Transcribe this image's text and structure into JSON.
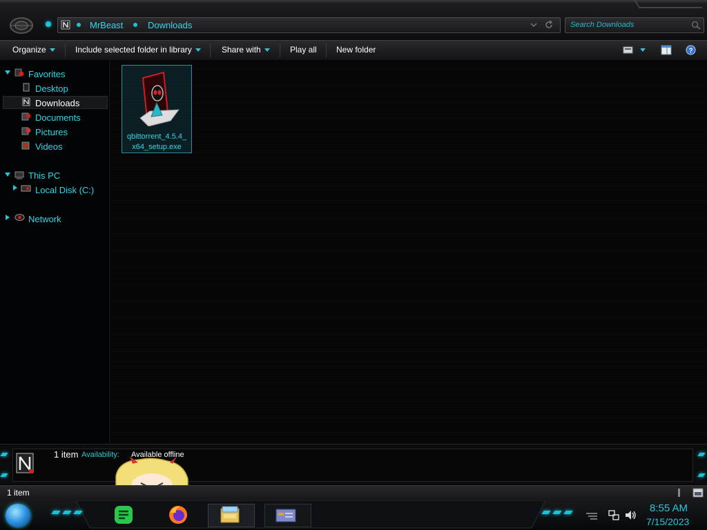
{
  "window": {
    "address": {
      "crumbs": [
        "MrBeast",
        "Downloads"
      ]
    },
    "search": {
      "placeholder": "Search Downloads"
    }
  },
  "toolbar": {
    "organize": "Organize",
    "include_library": "Include selected folder in library",
    "share_with": "Share with",
    "play_all": "Play all",
    "new_folder": "New folder"
  },
  "nav": {
    "favorites": {
      "label": "Favorites",
      "items": [
        "Desktop",
        "Downloads",
        "Documents",
        "Pictures",
        "Videos"
      ]
    },
    "this_pc": {
      "label": "This PC",
      "items": [
        "Local Disk (C:)"
      ]
    },
    "network": {
      "label": "Network"
    }
  },
  "files": [
    {
      "name_line1": "qbittorrent_4.5.4_",
      "name_line2": "x64_setup.exe",
      "icon": "alien-installer-icon"
    }
  ],
  "details": {
    "count": "1 item",
    "availability_label": "Availability:",
    "availability_value": "Available offline"
  },
  "status": {
    "count": "1 item"
  },
  "taskbar": {
    "time": "8:55 AM",
    "date": "7/15/2023",
    "apps": [
      "notes-app-icon",
      "firefox-icon",
      "file-explorer-icon",
      "window-icon"
    ]
  },
  "colors": {
    "accent": "#29c6d8",
    "background": "#000000"
  }
}
